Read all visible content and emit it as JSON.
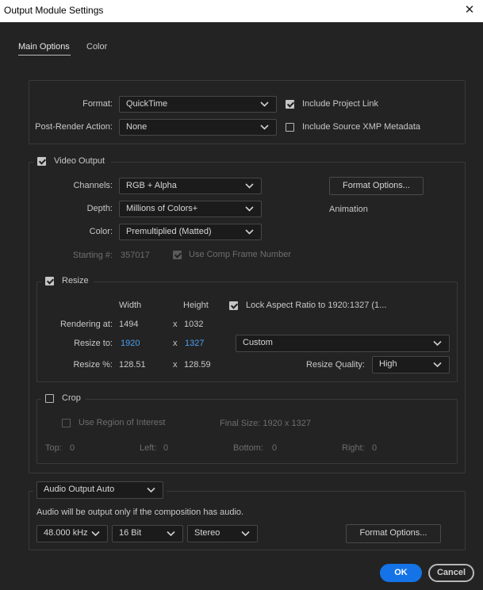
{
  "window": {
    "title": "Output Module Settings",
    "close_glyph": "✕"
  },
  "tabs": [
    {
      "label": "Main Options",
      "active": true
    },
    {
      "label": "Color",
      "active": false
    }
  ],
  "format": {
    "format_label": "Format:",
    "format_value": "QuickTime",
    "post_render_label": "Post-Render Action:",
    "post_render_value": "None",
    "include_project_link": {
      "label": "Include Project Link",
      "checked": true
    },
    "include_xmp": {
      "label": "Include Source XMP Metadata",
      "checked": false
    }
  },
  "video": {
    "label": "Video Output",
    "checked": true,
    "channels_label": "Channels:",
    "channels_value": "RGB + Alpha",
    "depth_label": "Depth:",
    "depth_value": "Millions of Colors+",
    "color_label": "Color:",
    "color_value": "Premultiplied (Matted)",
    "format_options_label": "Format Options...",
    "codec_label": "Animation",
    "starting_label": "Starting #:",
    "starting_value": "357017",
    "use_comp_frame": {
      "label": "Use Comp Frame Number",
      "checked": true
    }
  },
  "resize": {
    "label": "Resize",
    "checked": true,
    "width_header": "Width",
    "height_header": "Height",
    "lock_aspect": {
      "label": "Lock Aspect Ratio to 1920:1327 (1...",
      "checked": true
    },
    "rendering_label": "Rendering at:",
    "rendering_w": "1494",
    "rendering_h": "1032",
    "resize_to_label": "Resize to:",
    "resize_to_w": "1920",
    "resize_to_h": "1327",
    "resize_pct_label": "Resize %:",
    "resize_pct_w": "128.51",
    "resize_pct_h": "128.59",
    "times": "x",
    "preset_value": "Custom",
    "quality_label": "Resize Quality:",
    "quality_value": "High"
  },
  "crop": {
    "label": "Crop",
    "checked": false,
    "roi": {
      "label": "Use Region of Interest",
      "checked": false
    },
    "final_size": "Final Size: 1920 x 1327",
    "top_label": "Top:",
    "top_value": "0",
    "left_label": "Left:",
    "left_value": "0",
    "bottom_label": "Bottom:",
    "bottom_value": "0",
    "right_label": "Right:",
    "right_value": "0"
  },
  "audio": {
    "mode_value": "Audio Output Auto",
    "note": "Audio will be output only if the composition has audio.",
    "rate_value": "48.000 kHz",
    "bits_value": "16 Bit",
    "channels_value": "Stereo",
    "format_options_label": "Format Options..."
  },
  "footer": {
    "ok_label": "OK",
    "cancel_label": "Cancel"
  },
  "colors": {
    "accent": "#1473e6",
    "link_value": "#4d9ff0"
  }
}
